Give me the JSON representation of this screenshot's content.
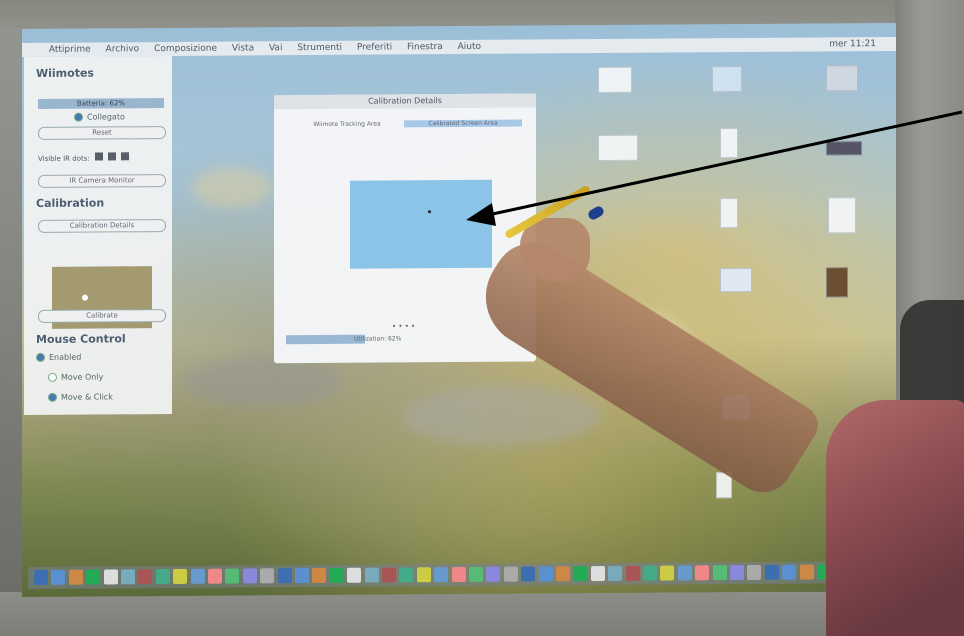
{
  "menubar": {
    "items": [
      "Attiprime",
      "Archivo",
      "Composizione",
      "Vista",
      "Vai",
      "Strumenti",
      "Preferiti",
      "Finestra",
      "Aiuto"
    ],
    "clock": "mer 11:21"
  },
  "panel": {
    "title": "Wiimotes",
    "wiimote_status": "Batteria: 62%",
    "connect_label": "Collegato",
    "reset_label": "Reset",
    "visible_ir_label": "Visible IR dots:",
    "camera_monitor_label": "IR Camera Monitor",
    "calibration_title": "Calibration",
    "calibration_details_label": "Calibration Details",
    "calibrate_label": "Calibrate",
    "mouse_control_title": "Mouse Control",
    "mouse_options": [
      "Enabled",
      "Move Only",
      "Move & Click"
    ]
  },
  "calibration_window": {
    "title": "Calibration Details",
    "tabs": [
      "Wiimote Tracking Area",
      "Calibrated Screen Area"
    ],
    "active_tab": 1,
    "progress_label": "Utilization: 62%",
    "progress_value": 0.33
  },
  "colors": {
    "calibration_area": "#8cc4e8",
    "window_bg": "#f5f6f8",
    "pen_tip": "#1e3f8a"
  }
}
